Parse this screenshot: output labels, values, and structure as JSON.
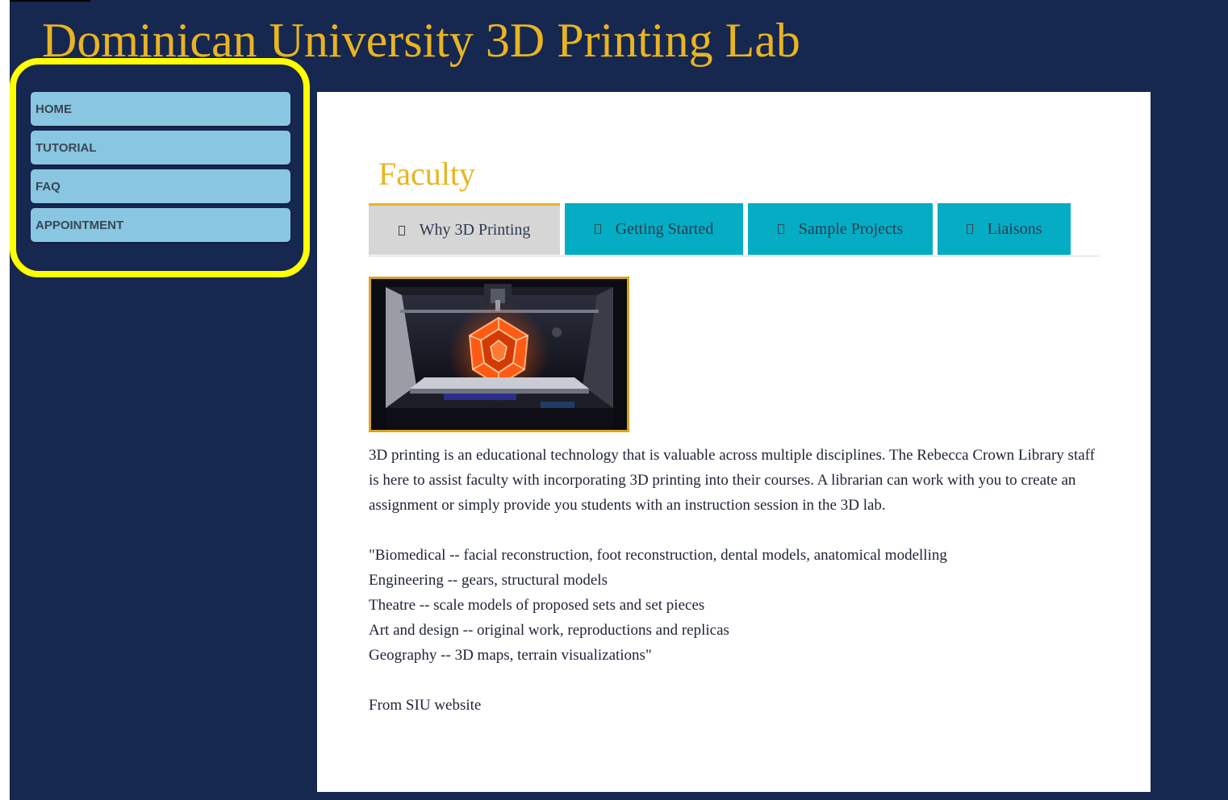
{
  "site": {
    "title": "Dominican University 3D Printing Lab"
  },
  "nav": {
    "items": [
      {
        "label": "HOME"
      },
      {
        "label": "TUTORIAL"
      },
      {
        "label": "FAQ"
      },
      {
        "label": "APPOINTMENT"
      }
    ],
    "highlight_color": "#ffff00"
  },
  "main": {
    "section_title": "Faculty",
    "tabs": [
      {
        "label": "Why 3D Printing",
        "active": true
      },
      {
        "label": "Getting Started",
        "active": false
      },
      {
        "label": "Sample Projects",
        "active": false
      },
      {
        "label": "Liaisons",
        "active": false
      }
    ],
    "intro": "3D printing is an educational technology that is valuable across multiple disciplines. The Rebecca Crown Library staff is here to assist faculty with incorporating 3D printing into their courses. A librarian can work with you to create an assignment or simply provide you students with an instruction session in the 3D lab.",
    "quote_lines": [
      "\"Biomedical -- facial reconstruction, foot reconstruction, dental models, anatomical modelling",
      "Engineering -- gears, structural models",
      "Theatre -- scale models of proposed sets and set pieces",
      "Art and design -- original work, reproductions and replicas",
      "Geography -- 3D maps, terrain visualizations\""
    ],
    "source": "From SIU website"
  },
  "colors": {
    "background": "#162750",
    "accent_gold": "#e8b422",
    "nav_item": "#89c6e1",
    "tab_inactive": "#04adc4",
    "tab_active": "#d6d6d6"
  }
}
